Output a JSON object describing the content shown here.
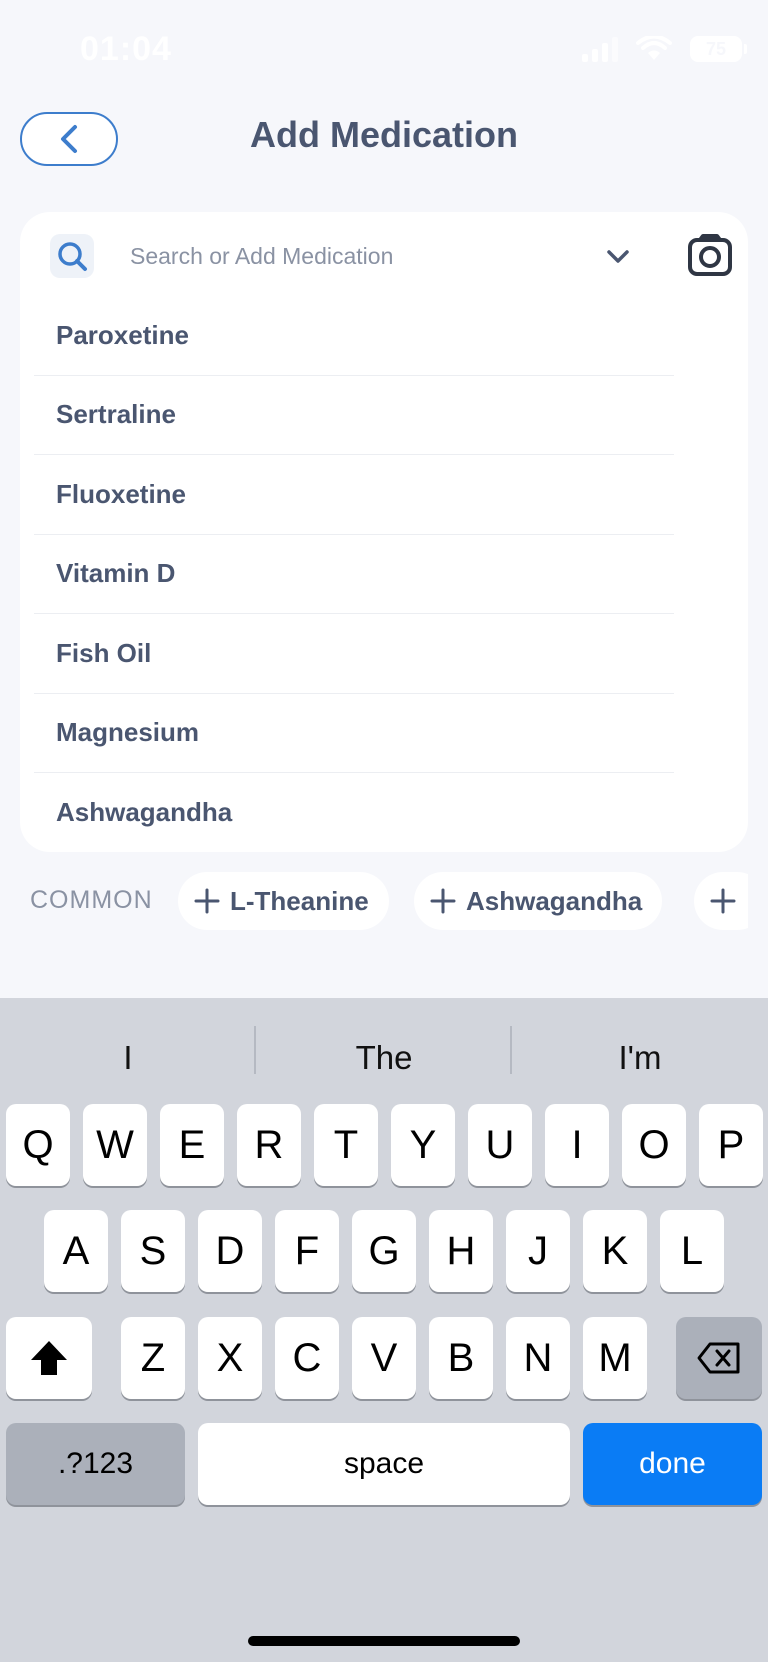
{
  "status_bar": {
    "time": "01:04",
    "battery": "75"
  },
  "header": {
    "title": "Add Medication"
  },
  "search": {
    "placeholder": "Search or Add Medication",
    "value": "",
    "results": [
      "Paroxetine",
      "Sertraline",
      "Fluoxetine",
      "Vitamin D",
      "Fish Oil",
      "Magnesium",
      "Ashwagandha"
    ]
  },
  "common": {
    "label": "COMMON",
    "chips": [
      "L-Theanine",
      "Ashwagandha",
      ""
    ]
  },
  "keyboard": {
    "suggestions": [
      "I",
      "The",
      "I'm"
    ],
    "row1": [
      "Q",
      "W",
      "E",
      "R",
      "T",
      "Y",
      "U",
      "I",
      "O",
      "P"
    ],
    "row2": [
      "A",
      "S",
      "D",
      "F",
      "G",
      "H",
      "J",
      "K",
      "L"
    ],
    "row3": [
      "Z",
      "X",
      "C",
      "V",
      "B",
      "N",
      "M"
    ],
    "numbers_label": ".?123",
    "space_label": "space",
    "done_label": "done"
  },
  "colors": {
    "accent": "#3d7dcc",
    "done": "#0a7cf5",
    "text": "#4a5670",
    "background": "#f6f7fb"
  }
}
